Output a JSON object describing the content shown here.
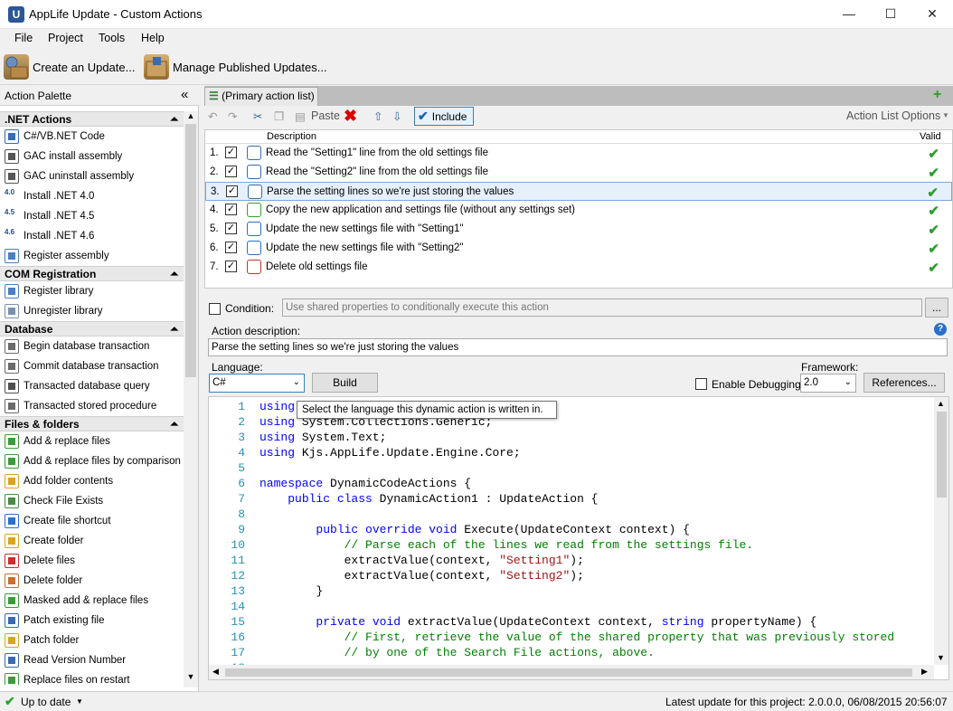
{
  "window": {
    "title": "AppLife Update - Custom Actions",
    "app_icon_letter": "U",
    "minimize": "—",
    "maximize": "☐",
    "close": "✕"
  },
  "menu": [
    "File",
    "Project",
    "Tools",
    "Help"
  ],
  "toolbar": {
    "create_update": "Create an Update...",
    "manage_published": "Manage Published Updates..."
  },
  "palette": {
    "title": "Action Palette",
    "collapse_glyph": "«",
    "categories": [
      {
        "name": ".NET Actions",
        "items": [
          {
            "label": "C#/VB.NET Code",
            "icon": "code-icon"
          },
          {
            "label": "GAC install assembly",
            "icon": "gac-icon"
          },
          {
            "label": "GAC uninstall assembly",
            "icon": "gac-icon"
          },
          {
            "label": "Install .NET 4.0",
            "icon": "dotnet-icon",
            "badge": "4.0"
          },
          {
            "label": "Install .NET 4.5",
            "icon": "dotnet-icon",
            "badge": "4.5"
          },
          {
            "label": "Install .NET 4.6",
            "icon": "dotnet-icon",
            "badge": "4.6"
          },
          {
            "label": "Register assembly",
            "icon": "register-icon"
          }
        ]
      },
      {
        "name": "COM Registration",
        "items": [
          {
            "label": "Register library",
            "icon": "register-icon"
          },
          {
            "label": "Unregister library",
            "icon": "unregister-icon"
          }
        ]
      },
      {
        "name": "Database",
        "items": [
          {
            "label": "Begin database transaction",
            "icon": "database-icon"
          },
          {
            "label": "Commit database transaction",
            "icon": "database-icon"
          },
          {
            "label": "Transacted database query",
            "icon": "sql-icon"
          },
          {
            "label": "Transacted stored procedure",
            "icon": "database-icon"
          }
        ]
      },
      {
        "name": "Files & folders",
        "items": [
          {
            "label": "Add & replace files",
            "icon": "add-file-icon"
          },
          {
            "label": "Add & replace files by comparison",
            "icon": "add-file-icon"
          },
          {
            "label": "Add folder contents",
            "icon": "folder-icon"
          },
          {
            "label": "Check File Exists",
            "icon": "check-file-icon"
          },
          {
            "label": "Create file shortcut",
            "icon": "shortcut-icon"
          },
          {
            "label": "Create folder",
            "icon": "folder-icon"
          },
          {
            "label": "Delete files",
            "icon": "delete-file-icon"
          },
          {
            "label": "Delete folder",
            "icon": "delete-folder-icon"
          },
          {
            "label": "Masked add & replace files",
            "icon": "add-file-icon"
          },
          {
            "label": "Patch existing file",
            "icon": "patch-icon"
          },
          {
            "label": "Patch folder",
            "icon": "folder-icon"
          },
          {
            "label": "Read Version Number",
            "icon": "version-icon"
          },
          {
            "label": "Replace files on restart",
            "icon": "add-file-icon"
          }
        ]
      }
    ]
  },
  "doc_tab": {
    "label": "(Primary action list)",
    "add_glyph": "+"
  },
  "list_toolbar": {
    "paste": "Paste",
    "include": "Include",
    "options": "Action List Options"
  },
  "grid": {
    "col_description": "Description",
    "col_valid": "Valid",
    "rows": [
      {
        "num": "1.",
        "text": "Read the \"Setting1\" line from the old settings file",
        "selected": false
      },
      {
        "num": "2.",
        "text": "Read the \"Setting2\" line from the old settings file",
        "selected": false
      },
      {
        "num": "3.",
        "text": "Parse the setting lines so we're just storing the values",
        "selected": true
      },
      {
        "num": "4.",
        "text": "Copy the new application and settings file (without any settings set)",
        "selected": false
      },
      {
        "num": "5.",
        "text": "Update the new settings file with \"Setting1\"",
        "selected": false
      },
      {
        "num": "6.",
        "text": "Update the new settings file with \"Setting2\"",
        "selected": false
      },
      {
        "num": "7.",
        "text": "Delete old settings file",
        "selected": false
      }
    ]
  },
  "details": {
    "condition_label": "Condition:",
    "condition_placeholder": "Use shared properties to conditionally execute this action",
    "ellipsis": "...",
    "action_description_label": "Action description:",
    "action_description_value": "Parse the setting lines so we're just storing the values",
    "language_label": "Language:",
    "language_value": "C#",
    "build": "Build",
    "enable_debugging": "Enable Debugging",
    "framework_label": "Framework:",
    "framework_value": "2.0",
    "references": "References...",
    "help_glyph": "?"
  },
  "tooltip": "Select the language this dynamic action is written in.",
  "code": [
    {
      "n": "1",
      "parts": [
        [
          "kw",
          "using"
        ],
        [
          "",
          " System;"
        ]
      ]
    },
    {
      "n": "2",
      "parts": [
        [
          "kw",
          "using"
        ],
        [
          "",
          " System.Collections.Generic;"
        ]
      ]
    },
    {
      "n": "3",
      "parts": [
        [
          "kw",
          "using"
        ],
        [
          "",
          " System.Text;"
        ]
      ]
    },
    {
      "n": "4",
      "parts": [
        [
          "kw",
          "using"
        ],
        [
          "",
          " Kjs.AppLife.Update.Engine.Core;"
        ]
      ]
    },
    {
      "n": "5",
      "parts": []
    },
    {
      "n": "6",
      "parts": [
        [
          "kw",
          "namespace"
        ],
        [
          "",
          " DynamicCodeActions {"
        ]
      ]
    },
    {
      "n": "7",
      "parts": [
        [
          "",
          "    "
        ],
        [
          "kw",
          "public class"
        ],
        [
          "",
          " DynamicAction1 : UpdateAction {"
        ]
      ]
    },
    {
      "n": "8",
      "parts": []
    },
    {
      "n": "9",
      "parts": [
        [
          "",
          "        "
        ],
        [
          "kw",
          "public override void"
        ],
        [
          "",
          " Execute(UpdateContext context) {"
        ]
      ]
    },
    {
      "n": "10",
      "parts": [
        [
          "",
          "            "
        ],
        [
          "cm",
          "// Parse each of the lines we read from the settings file."
        ]
      ]
    },
    {
      "n": "11",
      "parts": [
        [
          "",
          "            extractValue(context, "
        ],
        [
          "st",
          "\"Setting1\""
        ],
        [
          "",
          ");"
        ]
      ]
    },
    {
      "n": "12",
      "parts": [
        [
          "",
          "            extractValue(context, "
        ],
        [
          "st",
          "\"Setting2\""
        ],
        [
          "",
          ");"
        ]
      ]
    },
    {
      "n": "13",
      "parts": [
        [
          "",
          "        }"
        ]
      ]
    },
    {
      "n": "14",
      "parts": []
    },
    {
      "n": "15",
      "parts": [
        [
          "",
          "        "
        ],
        [
          "kw",
          "private void"
        ],
        [
          "",
          " extractValue(UpdateContext context, "
        ],
        [
          "kw",
          "string"
        ],
        [
          "",
          " propertyName) {"
        ]
      ]
    },
    {
      "n": "16",
      "parts": [
        [
          "",
          "            "
        ],
        [
          "cm",
          "// First, retrieve the value of the shared property that was previously stored"
        ]
      ]
    },
    {
      "n": "17",
      "parts": [
        [
          "",
          "            "
        ],
        [
          "cm",
          "// by one of the Search File actions, above."
        ]
      ]
    },
    {
      "n": "18",
      "parts": []
    }
  ],
  "status": {
    "left": "Up to date",
    "right": "Latest update for this project: 2.0.0.0, 06/08/2015 20:56:07"
  }
}
